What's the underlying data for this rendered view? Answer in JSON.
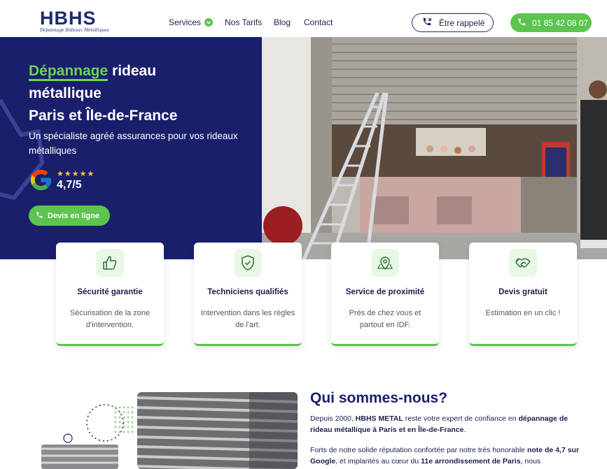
{
  "header": {
    "logo": {
      "main": "HBHS",
      "tagline": "Dépannage Rideaux Métalliques"
    },
    "nav": [
      {
        "label": "Services"
      },
      {
        "label": "Nos Tarifs"
      },
      {
        "label": "Blog"
      },
      {
        "label": "Contact"
      }
    ],
    "callback_label": "Être rappelé",
    "phone_label": "01 85 42 08 07"
  },
  "hero": {
    "title_accent": "Dépannage",
    "title_rest1": " rideau",
    "title_line2": "métallique",
    "title_line3": "Paris et Île-de-France",
    "subtitle": "Un spécialiste agréé assurances pour vos rideaux métalliques",
    "stars": "★★★★★",
    "rating": "4,7/5",
    "cta_label": "Devis en ligne"
  },
  "features": [
    {
      "icon": "thumbs-up-icon",
      "title": "Sécurité garantie",
      "text": "Sécurisation de la zone d'intervention."
    },
    {
      "icon": "shield-check-icon",
      "title": "Techniciens qualifiés",
      "text": "Intervention dans les règles de l'art."
    },
    {
      "icon": "map-pin-icon",
      "title": "Service de proximité",
      "text": "Près de chez vous et partout en IDF."
    },
    {
      "icon": "handshake-icon",
      "title": "Devis gratuit",
      "text": "Estimation en un clic !"
    }
  ],
  "about": {
    "title": "Qui sommes-nous?",
    "p1_a": "Depuis 2000, ",
    "p1_b": "HBHS METAL",
    "p1_c": " reste votre expert de confiance en ",
    "p1_d": "dépannage de rideau métallique à Paris et en Île-de-France",
    "p1_e": ".",
    "p2_a": "Forts de notre solide réputation confortée par notre très honorable ",
    "p2_b": "note de 4,7 sur Google",
    "p2_c": ", et implantés au cœur du ",
    "p2_d": "11e arrondissement de Paris",
    "p2_e": ", nous"
  },
  "colors": {
    "navy": "#1a1f6b",
    "green": "#5cc44f",
    "star": "#f6c445"
  }
}
